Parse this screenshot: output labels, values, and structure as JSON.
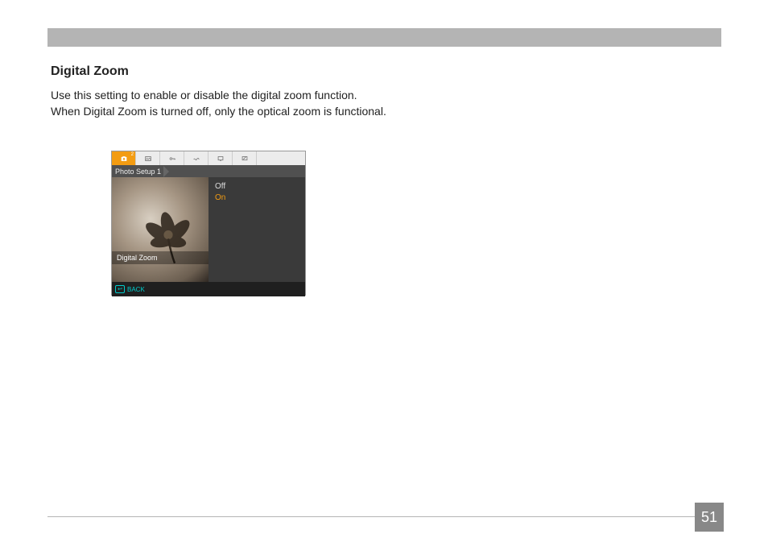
{
  "section": {
    "title": "Digital Zoom",
    "body": "Use this setting to enable or disable the digital zoom function. When Digital Zoom is turned off, only the optical zoom is functional."
  },
  "screenshot": {
    "tab_badge": "2",
    "breadcrumb": "Photo Setup 1",
    "options": {
      "off": "Off",
      "on": "On"
    },
    "setting_label": "Digital Zoom",
    "back": "BACK"
  },
  "page_number": "51"
}
